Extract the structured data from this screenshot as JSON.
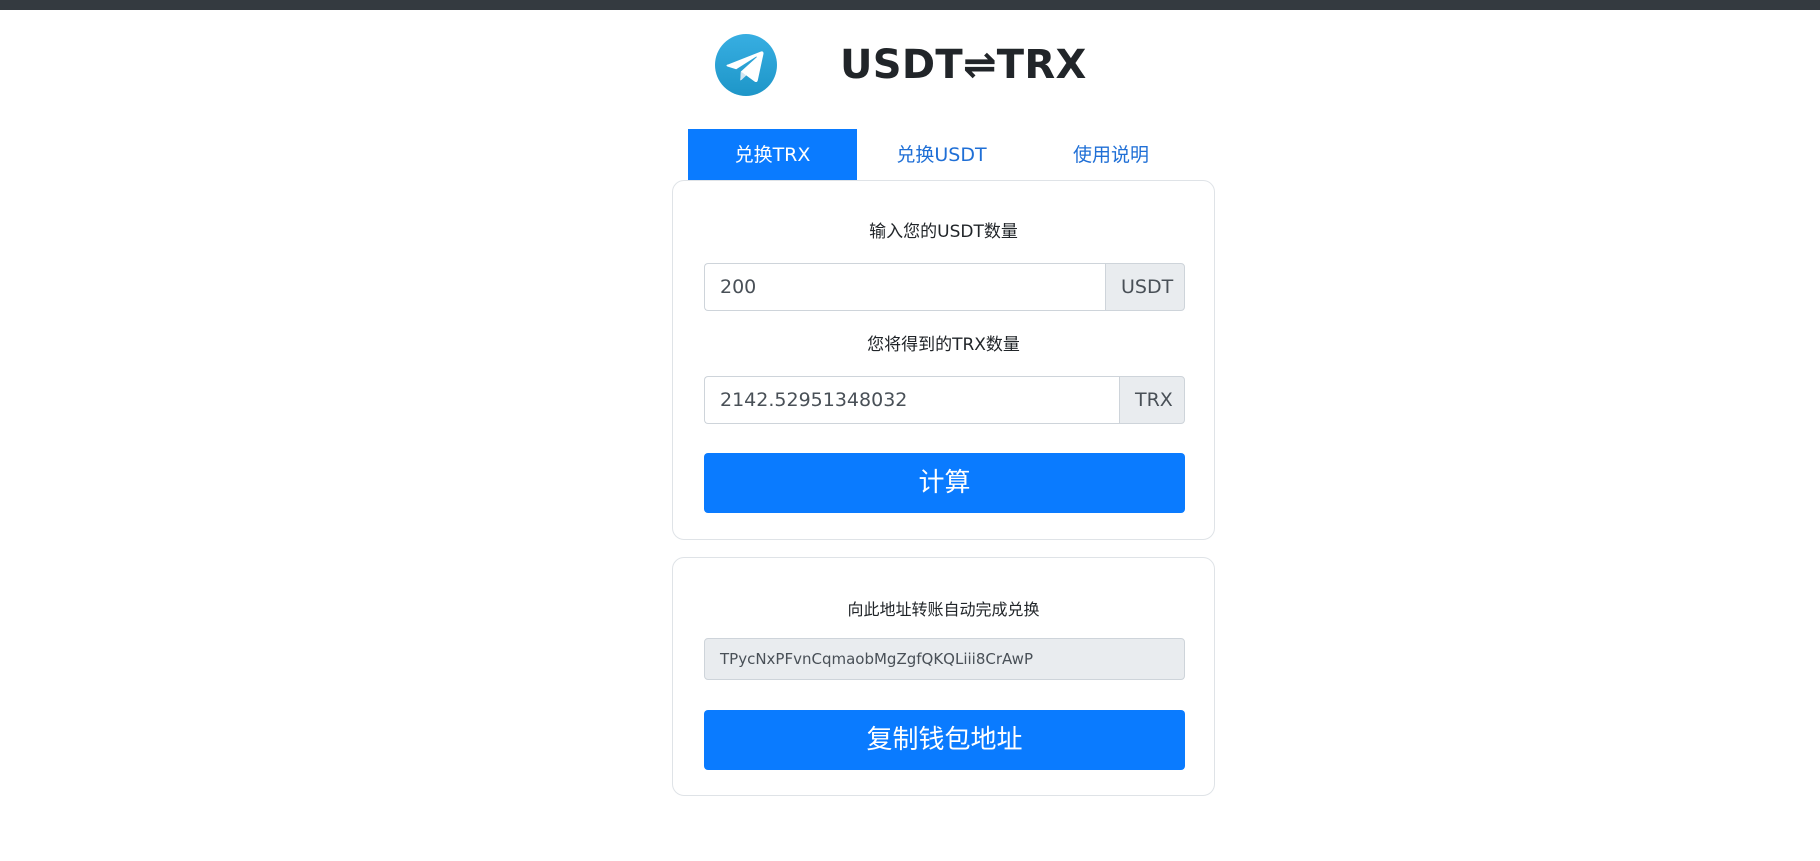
{
  "header": {
    "title": "USDT⇌TRX",
    "logo_icon": "telegram-icon",
    "logo_colors": {
      "circle_top": "#37aee2",
      "circle_bottom": "#1e96c8",
      "plane": "#ffffff"
    }
  },
  "tabs": [
    {
      "label": "兑换TRX",
      "active": true
    },
    {
      "label": "兑换USDT",
      "active": false
    },
    {
      "label": "使用说明",
      "active": false
    }
  ],
  "exchange": {
    "usdt_label": "输入您的USDT数量",
    "usdt_value": "200",
    "usdt_unit": "USDT",
    "trx_label": "您将得到的TRX数量",
    "trx_value": "2142.52951348032",
    "trx_unit": "TRX",
    "calc_button": "计算"
  },
  "wallet": {
    "label": "向此地址转账自动完成兑换",
    "address": "TPycNxPFvnCqmaobMgZgfQKQLiii8CrAwP",
    "copy_button": "复制钱包地址"
  },
  "colors": {
    "primary": "#0a7bff",
    "topbar": "#343a40",
    "addon_bg": "#e9ecef"
  }
}
